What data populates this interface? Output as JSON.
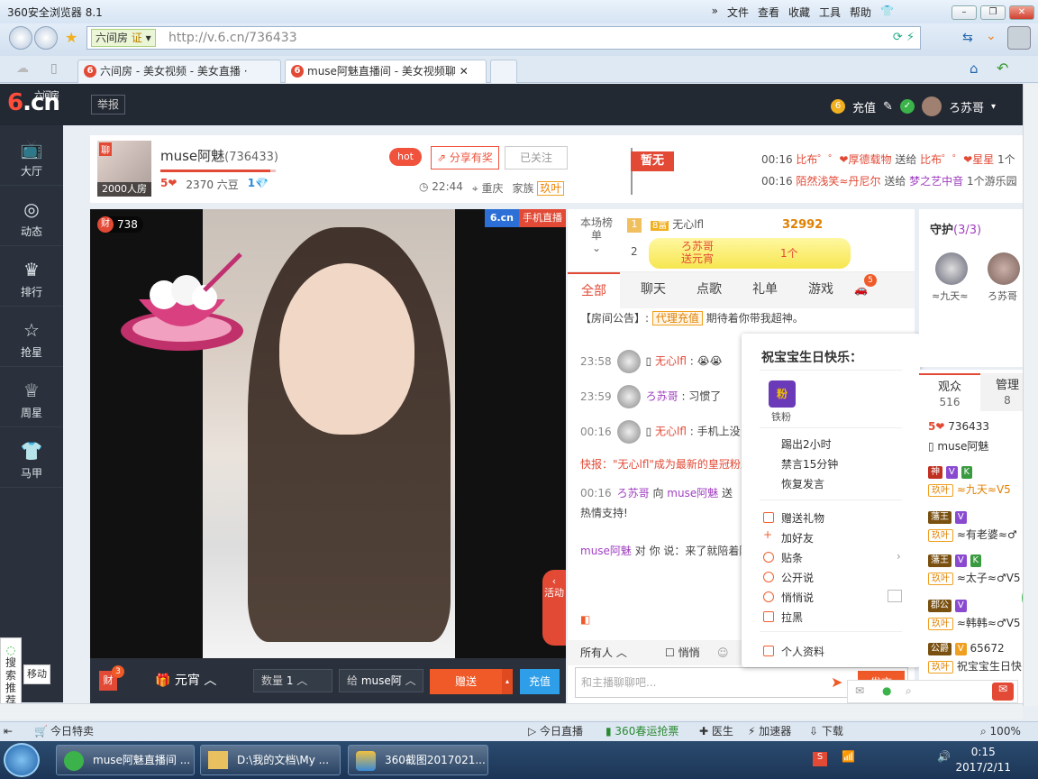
{
  "browser": {
    "title": "360安全浏览器 8.1",
    "menu": [
      "文件",
      "查看",
      "收藏",
      "工具",
      "帮助"
    ],
    "site_badge": "六间房",
    "site_cert": "证",
    "url": "http://v.6.cn/736433",
    "tabs": [
      {
        "label": "六间房 - 美女视频 - 美女直播 ·"
      },
      {
        "label": "muse阿魅直播间 - 美女视频聊"
      }
    ]
  },
  "header": {
    "logo_brand": "六间房",
    "logo_text": ".cn",
    "report_label": "举报",
    "charge_label": "充值",
    "user_name": "ろ苏哥"
  },
  "leftnav": {
    "items": [
      {
        "icon": "tv-icon",
        "label": "大厅"
      },
      {
        "icon": "compass-icon",
        "label": "动态"
      },
      {
        "icon": "crown-icon",
        "label": "排行"
      },
      {
        "icon": "star-icon",
        "label": "抢星"
      },
      {
        "icon": "cup-icon",
        "label": "周星"
      },
      {
        "icon": "shirt-icon",
        "label": "马甲"
      }
    ],
    "search_rec": "搜索推荐",
    "mobile": "移动版"
  },
  "room": {
    "avatar_badge": "聊",
    "avatar_caption": "2000人房",
    "host_name": "muse阿魅",
    "host_id": "(736433)",
    "level_progress": 0.95,
    "wealth_level": "5",
    "beans": "2370 六豆",
    "diamond_level": "1",
    "hot_label": "hot",
    "share_label": "分享有奖",
    "follow_label": "已关注",
    "time": "22:44",
    "city": "重庆",
    "family_label": "家族",
    "family_name": "玖叶",
    "flag_label": "暂无",
    "ticker": [
      {
        "time": "00:16",
        "from": "比布゜゜❤厚德载物",
        "verb": "送给",
        "to": "比布゜゜❤星星",
        "tail": "1个"
      },
      {
        "time": "00:16",
        "from": "陌然浅笑≈丹尼尔",
        "verb": "送给",
        "to": "梦之艺中音",
        "tail": "1个游乐园"
      }
    ]
  },
  "video": {
    "wealth_count": "738",
    "wealth_icon": "财",
    "brand": "6.cn",
    "mobile_live": "手机直播",
    "activity_label": "活动",
    "gift_badge_count": "3",
    "gift_name": "元宵",
    "qty_label": "数量",
    "qty_value": "1",
    "to_label": "给",
    "to_value": "muse阿",
    "send_label": "赠送",
    "charge_label": "充值"
  },
  "chat": {
    "rank_label": "本场榜单",
    "rank": [
      {
        "pos": "1",
        "badge": "8富",
        "name": "无心lfl",
        "score": "32992"
      },
      {
        "pos": "2",
        "name": "ろ苏哥",
        "note": "送元宵",
        "count": "1个"
      }
    ],
    "tabs": [
      "全部",
      "聊天",
      "点歌",
      "礼单",
      "游戏"
    ],
    "car_count": "5",
    "notice_label": "【房间公告】:",
    "notice_tag": "代理充值",
    "notice_text": "期待着你带我超神。",
    "messages": [
      {
        "time": "23:58",
        "name": "无心lfl",
        "text": ":"
      },
      {
        "time": "23:59",
        "name": "ろ苏哥",
        "text": ": 习惯了"
      },
      {
        "time": "00:16",
        "name": "无心lfl",
        "text": ": 手机上没"
      }
    ],
    "bulletin": "快报：\"无心lfl\"成为最新的皇冠粉丝",
    "gift_msg_time": "00:16",
    "gift_msg_from": "ろ苏哥",
    "gift_msg_to_label": "向",
    "gift_msg_to": "muse阿魅",
    "gift_msg_verb": "送",
    "gift_msg_thanks": "热情支持!",
    "host_reply_name": "muse阿魅",
    "host_reply_text": "对 你 说：来了就陪着阿",
    "recipient": "所有人",
    "whisper_label": "悄悄",
    "input_placeholder": "和主播聊聊吧...",
    "send_label": "发言"
  },
  "ctxmenu": {
    "title": "祝宝宝生日快乐：",
    "fan_label": "铁粉",
    "fan_icon": "粉",
    "items_a": [
      "踢出2小时",
      "禁言15分钟",
      "恢复发言"
    ],
    "items_b": [
      "赠送礼物",
      "加好友",
      "贴条",
      "公开说",
      "悄悄说",
      "拉黑"
    ],
    "profile": "个人资料"
  },
  "guard": {
    "title": "守护",
    "count": "(3/3)",
    "members": [
      "≈九天≈",
      "ろ苏哥"
    ]
  },
  "audience": {
    "tab_audience": "观众",
    "audience_count": "516",
    "tab_admin": "管理",
    "admin_count": "8",
    "host_level": "5",
    "host_id": "736433",
    "host_name": "muse阿魅",
    "list": [
      {
        "badge": "神",
        "name": "≈九天≈V5",
        "fam": "玖叶"
      },
      {
        "badge": "藩王",
        "name": "≈有老婆≈♂",
        "fam": "玖叶"
      },
      {
        "badge": "藩王",
        "name": "≈太子≈♂V5",
        "fam": "玖叶"
      },
      {
        "badge": "郡公",
        "name": "≈韩韩≈♂V5",
        "fam": "玖叶"
      },
      {
        "badge": "公爵",
        "name": "65672",
        "fam": "玖叶",
        "extra": "祝宝宝生日快"
      }
    ],
    "side_badge": "47"
  },
  "statusbar": {
    "today": "今日特卖",
    "items": [
      "今日直播",
      "360春运抢票",
      "医生",
      "加速器",
      "下载"
    ],
    "zoom": "100%"
  },
  "taskbar": {
    "items": [
      "muse阿魅直播间 ...",
      "D:\\我的文档\\My ...",
      "360截图2017021..."
    ],
    "time": "0:15",
    "date": "2017/2/11"
  },
  "colors": {
    "accent": "#e24a36",
    "nav": "#2a313c",
    "blue": "#2e9ee8"
  }
}
